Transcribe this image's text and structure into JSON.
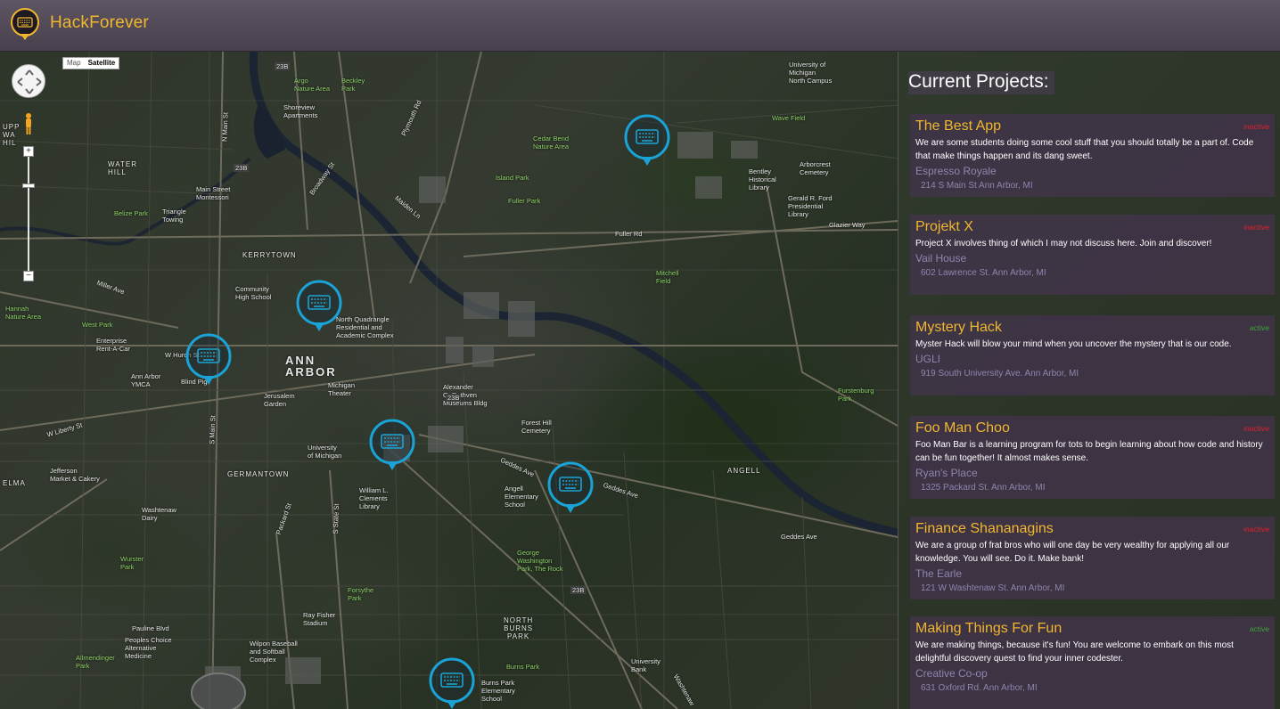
{
  "header": {
    "title": "HackForever",
    "logo_icon": "keyboard-icon",
    "accent": "#f0b72f"
  },
  "map": {
    "type_toggle": [
      {
        "label": "Map",
        "active": false
      },
      {
        "label": "Satellite",
        "active": true
      }
    ],
    "labels": {
      "ann_arbor": "ANN\nARBOR",
      "kerrytown": "KERRYTOWN",
      "germantown": "GERMANTOWN",
      "angell": "ANGELL",
      "north_burns_park": "NORTH\nBURNS\nPARK",
      "water_hill": "WATER\nHILL",
      "elma": "ELMA",
      "upper_water_hill": "UPP\nWA\nHIL",
      "beckley": "Beckley\nPark",
      "argo": "Argo\nNature Area",
      "shoreview": "Shoreview\nApartments",
      "belize": "Belize Park",
      "triangle": "Triangle\nTowing",
      "main_street_montessori": "Main Street\nMontessori",
      "west_park": "West Park",
      "hannah": "Hannah\nNature Area",
      "miller": "Miller Ave",
      "enterprise": "Enterprise\nRent-A-Car",
      "ann_arbor_ymca": "Ann Arbor\nYMCA",
      "blind_pig": "Blind Pig",
      "jefferson": "Jefferson\nMarket & Cakery",
      "washtenaw_dairy": "Washtenaw\nDairy",
      "wurster": "Wurster\nPark",
      "community_high": "Community\nHigh School",
      "north_quad": "North Quadrangle\nResidential and\nAcademic Complex",
      "michigan_theater": "Michigan\nTheater",
      "jerusalem": "Jerusalem\nGarden",
      "university_michigan": "University\nof Michigan",
      "william_clements": "William L.\nClements\nLibrary",
      "alexander": "Alexander\nG. Ruthven\nMuseums Bldg",
      "forest_hill": "Forest Hill\nCemetery",
      "angell_elementary": "Angell\nElementary\nSchool",
      "george_washington": "George\nWashington\nPark, The Rock",
      "cedar_bend": "Cedar Bend\nNature Area",
      "island_park": "Island Park",
      "fuller_park": "Fuller Park",
      "fuller_rd": "Fuller Rd",
      "mitchell_field": "Mitchell\nField",
      "bentley": "Bentley\nHistorical\nLibrary",
      "gerald_ford": "Gerald R. Ford\nPresidential\nLibrary",
      "arborcrest": "Arborcrest\nCemetery",
      "wave_field": "Wave Field",
      "north_campus": "University of\nMichigan\nNorth Campus",
      "glazier": "Glazier Way",
      "furstenburg": "Furstenburg\nPark",
      "geddes_ave": "Geddes Ave",
      "geddes_ave2": "Geddes Ave",
      "pauline": "Pauline Blvd",
      "peoples_choice": "Peoples Choice\nAlternative\nMedicine",
      "allmendinger": "Allmendinger\nPark",
      "forsythe": "Forsythe\nPark",
      "ray_fisher": "Ray Fisher\nStadium",
      "wilpon": "Wilpon Baseball\nand Softball\nComplex",
      "burns_park": "Burns Park",
      "burns_park_elem": "Burns Park\nElementary\nSchool",
      "university_bank": "University\nBank",
      "w_huron": "W Huron St",
      "w_liberty": "W Liberty St",
      "main_st": "S Main St",
      "n_main": "N Main St",
      "packard": "Packard St",
      "s_state": "S State St",
      "broadway": "Broadway St",
      "plymouth": "Plymouth Rd",
      "maiden": "Maiden Ln",
      "geddes_ave3": "Geddes Ave",
      "washtenaw": "Washtenaw",
      "r23b_1": "23B",
      "r23b_2": "23B",
      "r23b_3": "23B",
      "r23b_4": "23B"
    }
  },
  "sidebar": {
    "title": "Current Projects:",
    "projects": [
      {
        "title": "The Best App",
        "status": "inactive",
        "description": "We are some students doing some cool stuff that you should totally be a part of. Code that make things happen and its dang sweet.",
        "venue": "Espresso Royale",
        "address": "214 S Main St Ann Arbor, MI"
      },
      {
        "title": "Projekt X",
        "status": "inactive",
        "description": "Project X involves thing of which I may not discuss here. Join and discover!",
        "venue": "Vail House",
        "address": "602 Lawrence St. Ann Arbor, MI"
      },
      {
        "title": "Mystery Hack",
        "status": "active",
        "description": "Myster Hack will blow your mind when you uncover the mystery that is our code.",
        "venue": "UGLI",
        "address": "919 South University Ave. Ann Arbor, MI"
      },
      {
        "title": "Foo Man Choo",
        "status": "inactive",
        "description": "Foo Man Bar is a learning program for tots to begin learning about how code and history can be fun together! It almost makes sense.",
        "venue": "Ryan's Place",
        "address": "1325 Packard St. Ann Arbor, MI"
      },
      {
        "title": "Finance Shananagins",
        "status": "inactive",
        "description": "We are a group of frat bros who will one day be very wealthy for applying all our knowledge. You will see. Do it. Make bank!",
        "venue": "The Earle",
        "address": "121 W Washtenaw St. Ann Arbor, MI"
      },
      {
        "title": "Making Things For Fun",
        "status": "active",
        "description": "We are making things, because it's fun! You are welcome to embark on this most delightful discovery quest to find your inner codester.",
        "venue": "Creative Co-op",
        "address": "631 Oxford Rd. Ann Arbor, MI"
      }
    ]
  },
  "colors": {
    "inactive": "#e0202a",
    "active": "#3ba33b",
    "marker": "#1aa3d6",
    "card_bg": "#3e3446"
  }
}
